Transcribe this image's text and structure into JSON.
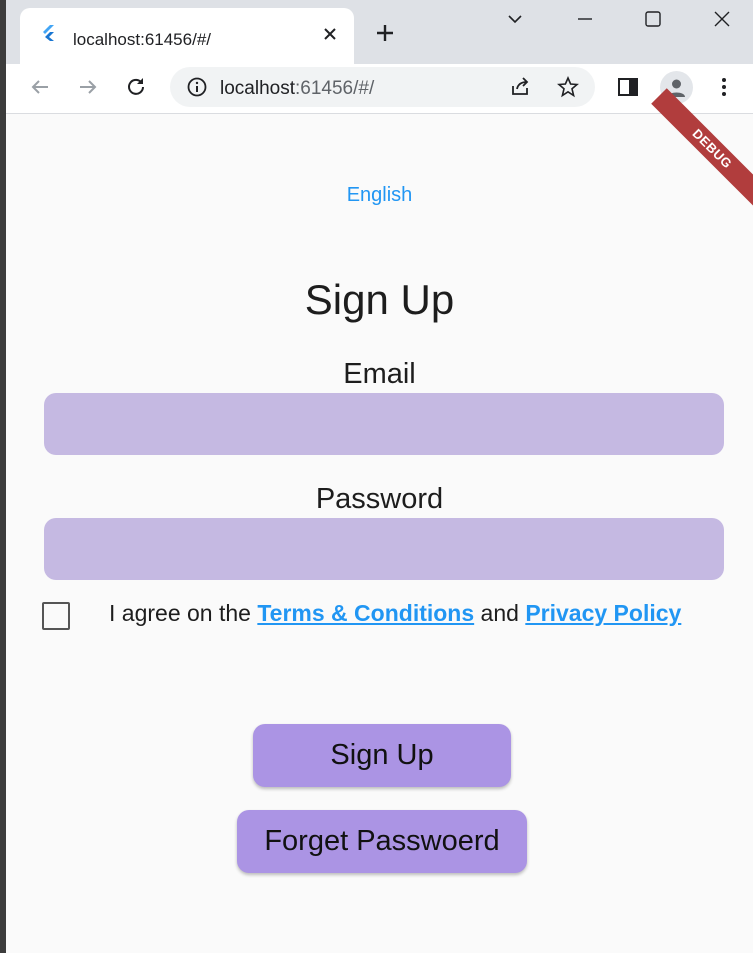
{
  "browser": {
    "tab_title": "localhost:61456/#/",
    "url_host": "localhost",
    "url_rest": ":61456/#/"
  },
  "page": {
    "debug_banner": "DEBUG",
    "language": "English",
    "title": "Sign Up",
    "email_label": "Email",
    "password_label": "Password",
    "agree_prefix": "I agree on the",
    "terms_link": "Terms & Conditions",
    "agree_and": "and",
    "privacy_link": "Privacy Policy",
    "signup_button": "Sign Up",
    "forgot_button": "Forget Passwoerd"
  },
  "colors": {
    "field_bg": "#c5b9e2",
    "button_bg": "#ab94e4",
    "link": "#2196f3",
    "debug": "#b13d3d"
  }
}
